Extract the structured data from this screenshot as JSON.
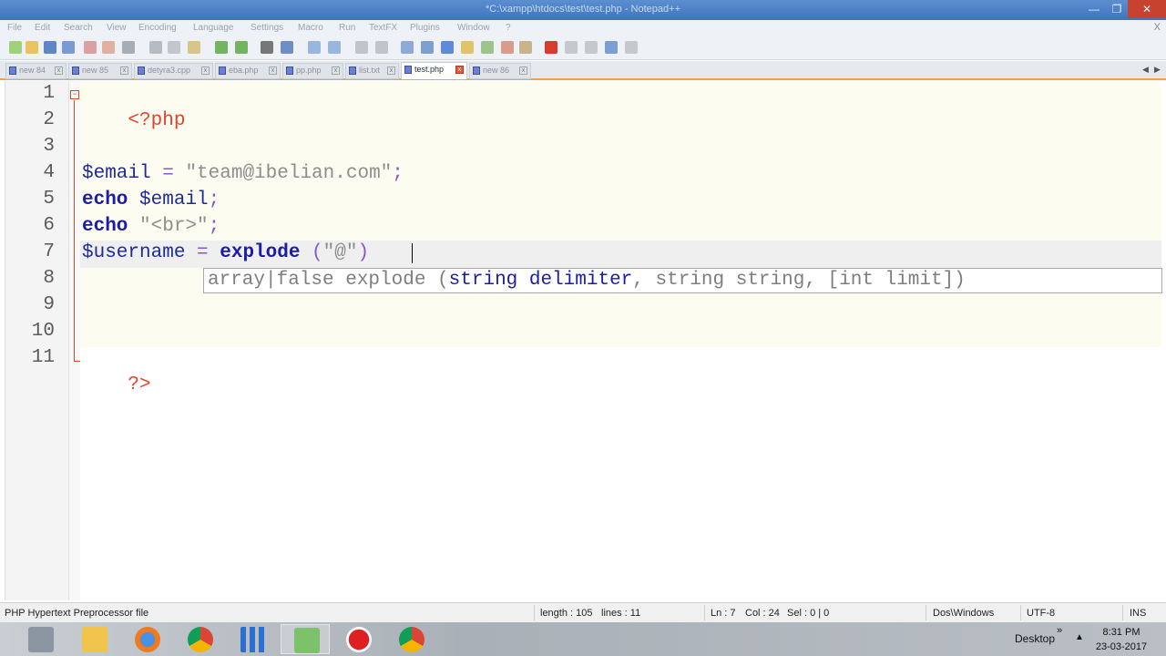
{
  "window": {
    "title": "*C:\\xampp\\htdocs\\test\\test.php - Notepad++",
    "controls": {
      "minimize": "—",
      "maximize": "❐",
      "close": "✕"
    }
  },
  "menubar": {
    "items": [
      "File",
      "Edit",
      "Search",
      "View",
      "Encoding",
      "Language",
      "Settings",
      "Macro",
      "Run",
      "TextFX",
      "Plugins",
      "Window",
      "?"
    ],
    "close_doc": "X"
  },
  "tabs": [
    {
      "label": "new 84",
      "active": false
    },
    {
      "label": "new 85",
      "active": false
    },
    {
      "label": "detyra3.cpp",
      "active": false
    },
    {
      "label": "eba.php",
      "active": false
    },
    {
      "label": "pp.php",
      "active": false
    },
    {
      "label": "list.txt",
      "active": false
    },
    {
      "label": "test.php",
      "active": true
    },
    {
      "label": "new 86",
      "active": false
    }
  ],
  "tab_scroll": {
    "left": "◀",
    "right": "▶"
  },
  "editor": {
    "line_numbers": [
      "1",
      "2",
      "3",
      "4",
      "5",
      "6",
      "7",
      "8",
      "9",
      "10",
      "11"
    ],
    "lines": {
      "l1": {
        "open": "<?php"
      },
      "l4": {
        "var": "$email",
        "op": " = ",
        "str": "\"team@ibelian.com\"",
        "end": ";"
      },
      "l5": {
        "kw": "echo",
        "sp": " ",
        "var": "$email",
        "end": ";"
      },
      "l6": {
        "kw": "echo",
        "sp": " ",
        "str": "\"<br>\"",
        "end": ";"
      },
      "l7": {
        "var": "$username",
        "op": " = ",
        "fn": "explode",
        "args_open": " (",
        "str": "\"@\"",
        "args_close": ")"
      },
      "l11": {
        "close": "?>"
      }
    },
    "fold_marker": "−",
    "cursor": {
      "line": 7,
      "col": 24
    }
  },
  "calltip": {
    "ret": "array|false explode (",
    "param": "string delimiter",
    "rest": ", string string, [int limit])"
  },
  "statusbar": {
    "filetype": "PHP Hypertext Preprocessor file",
    "length": "length : 105",
    "lines": "lines : 11",
    "ln": "Ln : 7",
    "col": "Col : 24",
    "sel": "Sel : 0 | 0",
    "eol": "Dos\\Windows",
    "encoding": "UTF-8",
    "mode": "INS"
  },
  "taskbar": {
    "apps": [
      {
        "name": "Recycle Bin"
      },
      {
        "name": "File Explorer"
      },
      {
        "name": "Firefox"
      },
      {
        "name": "Chrome"
      },
      {
        "name": "Apps"
      },
      {
        "name": "Notepad++"
      },
      {
        "name": "Recorder"
      },
      {
        "name": "Chrome"
      }
    ],
    "tray": {
      "desktop": "Desktop",
      "chevron": "»",
      "arrow": "▲",
      "time": "8:31 PM",
      "date": "23-03-2017"
    }
  },
  "colors": {
    "accent": "#f2a04a",
    "php_tag": "#e0452c",
    "keyword": "#1c1ca8",
    "variable": "#1f2a9a",
    "string": "#8d8d8d",
    "operator": "#8a57c7"
  }
}
